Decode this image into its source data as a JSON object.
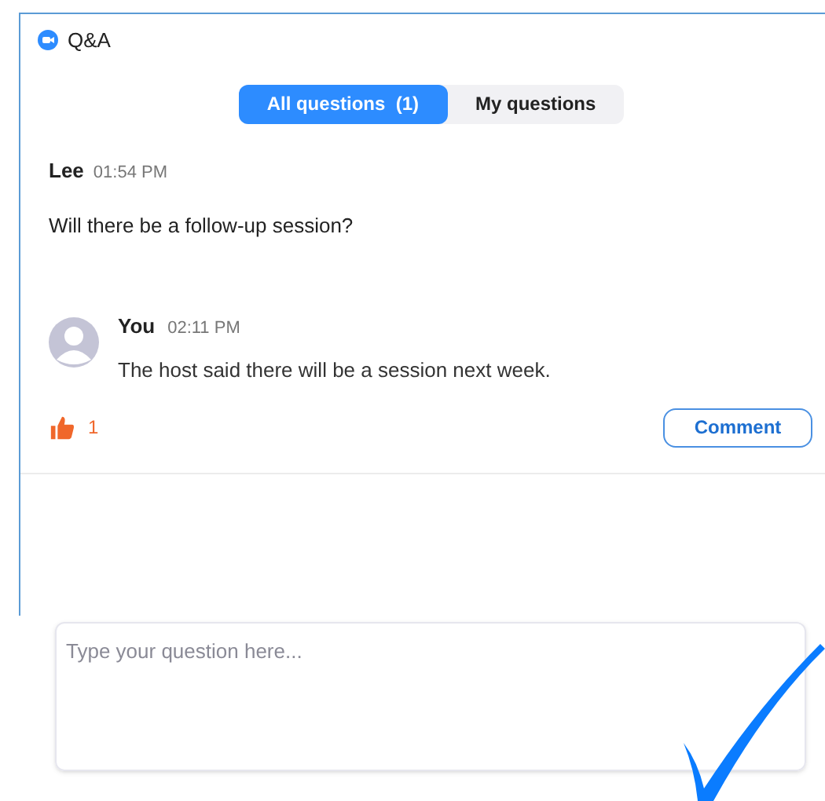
{
  "window": {
    "title": "Q&A"
  },
  "tabs": [
    {
      "label": "All questions  (1)",
      "selected": true
    },
    {
      "label": "My questions",
      "selected": false
    }
  ],
  "question": {
    "author": "Lee",
    "time": "01:54 PM",
    "text": "Will there be a follow-up session?"
  },
  "answer": {
    "author": "You",
    "time": "02:11 PM",
    "text": "The host said there will be a session next week."
  },
  "likes": {
    "count": "1",
    "liked": true
  },
  "comment_button": "Comment",
  "input": {
    "placeholder": "Type your question here..."
  }
}
